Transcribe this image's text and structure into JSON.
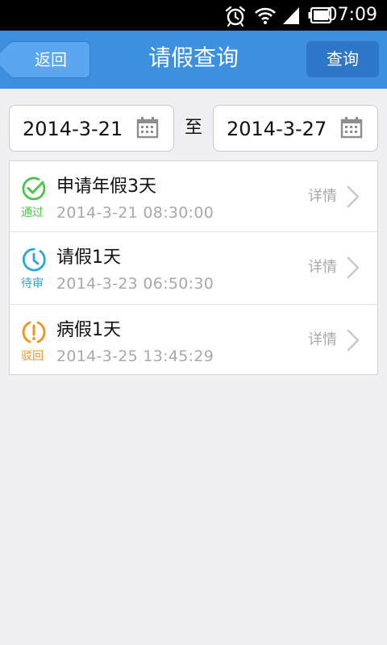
{
  "status_bar": {
    "time": "07:09",
    "icons": [
      "alarm-icon",
      "wifi-icon",
      "signal-icon",
      "battery-icon"
    ]
  },
  "app_bar": {
    "back_label": "返回",
    "title": "请假查询",
    "query_label": "查询",
    "color": "#3d8fe0"
  },
  "date_range": {
    "start": "2014-3-21",
    "separator": "至",
    "end": "2014-3-27",
    "icon": "calendar-icon"
  },
  "records": [
    {
      "title": "申请年假3天",
      "status": "通过",
      "timestamp": "2014-3-21   08:30:00",
      "detail_label": "详情",
      "icon": "check-circle-icon",
      "color": "#4cc44c"
    },
    {
      "title": "请假1天",
      "status": "待审",
      "timestamp": "2014-3-23   06:50:30",
      "detail_label": "详情",
      "icon": "clock-icon",
      "color": "#2aa6d8"
    },
    {
      "title": "病假1天",
      "status": "驳回",
      "timestamp": "2014-3-25   13:45:29",
      "detail_label": "详情",
      "icon": "exclamation-circle-icon",
      "color": "#f0941c"
    }
  ]
}
